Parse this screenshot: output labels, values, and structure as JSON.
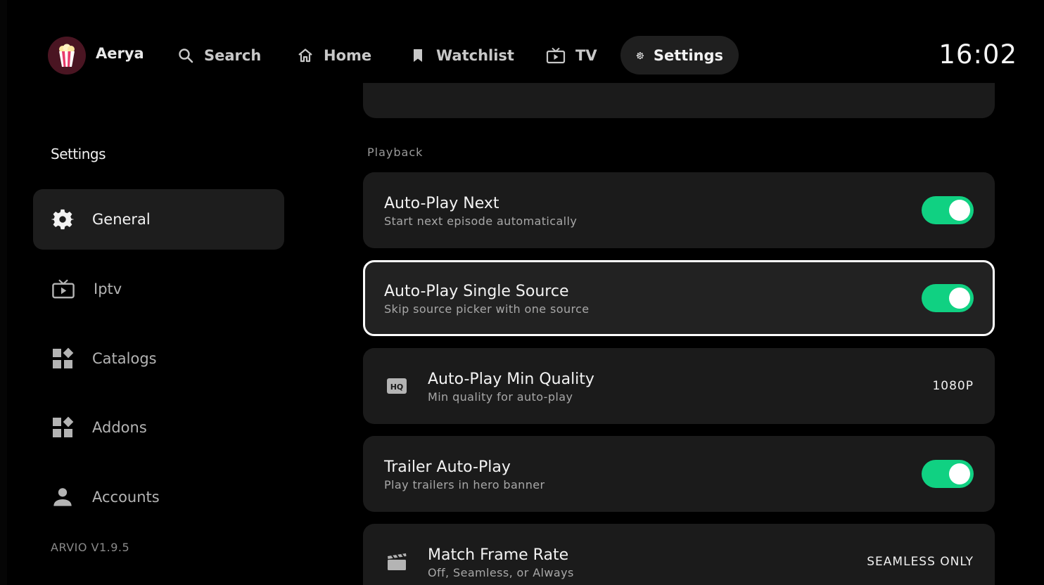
{
  "profile": {
    "name": "Aerya",
    "avatar_icon": "popcorn-icon"
  },
  "nav": [
    {
      "id": "search",
      "label": "Search",
      "icon": "search-icon"
    },
    {
      "id": "home",
      "label": "Home",
      "icon": "home-icon"
    },
    {
      "id": "watchlist",
      "label": "Watchlist",
      "icon": "bookmark-icon"
    },
    {
      "id": "tv",
      "label": "TV",
      "icon": "tv-icon"
    },
    {
      "id": "settings",
      "label": "Settings",
      "icon": "gear-icon",
      "active": true
    }
  ],
  "clock": "16:02",
  "sidebar": {
    "title": "Settings",
    "items": [
      {
        "label": "General",
        "icon": "gear-icon",
        "active": true
      },
      {
        "label": "Iptv",
        "icon": "tv-icon"
      },
      {
        "label": "Catalogs",
        "icon": "widgets-icon"
      },
      {
        "label": "Addons",
        "icon": "widgets-icon"
      },
      {
        "label": "Accounts",
        "icon": "person-icon"
      }
    ],
    "version": "ARVIO V1.9.5"
  },
  "main": {
    "section": "Playback",
    "settings": [
      {
        "title": "Auto-Play Next",
        "subtitle": "Start next episode automatically",
        "type": "toggle",
        "enabled": true
      },
      {
        "title": "Auto-Play Single Source",
        "subtitle": "Skip source picker with one source",
        "type": "toggle",
        "enabled": true,
        "focused": true
      },
      {
        "title": "Auto-Play Min Quality",
        "subtitle": "Min quality for auto-play",
        "type": "value",
        "value": "1080P",
        "icon": "hq-icon"
      },
      {
        "title": "Trailer Auto-Play",
        "subtitle": "Play trailers in hero banner",
        "type": "toggle",
        "enabled": true
      },
      {
        "title": "Match Frame Rate",
        "subtitle": "Off, Seamless, or Always",
        "type": "value",
        "value": "SEAMLESS ONLY",
        "icon": "clapperboard-icon"
      }
    ]
  },
  "colors": {
    "accent": "#10d182",
    "card": "#1b1b1b",
    "background": "#000000"
  }
}
